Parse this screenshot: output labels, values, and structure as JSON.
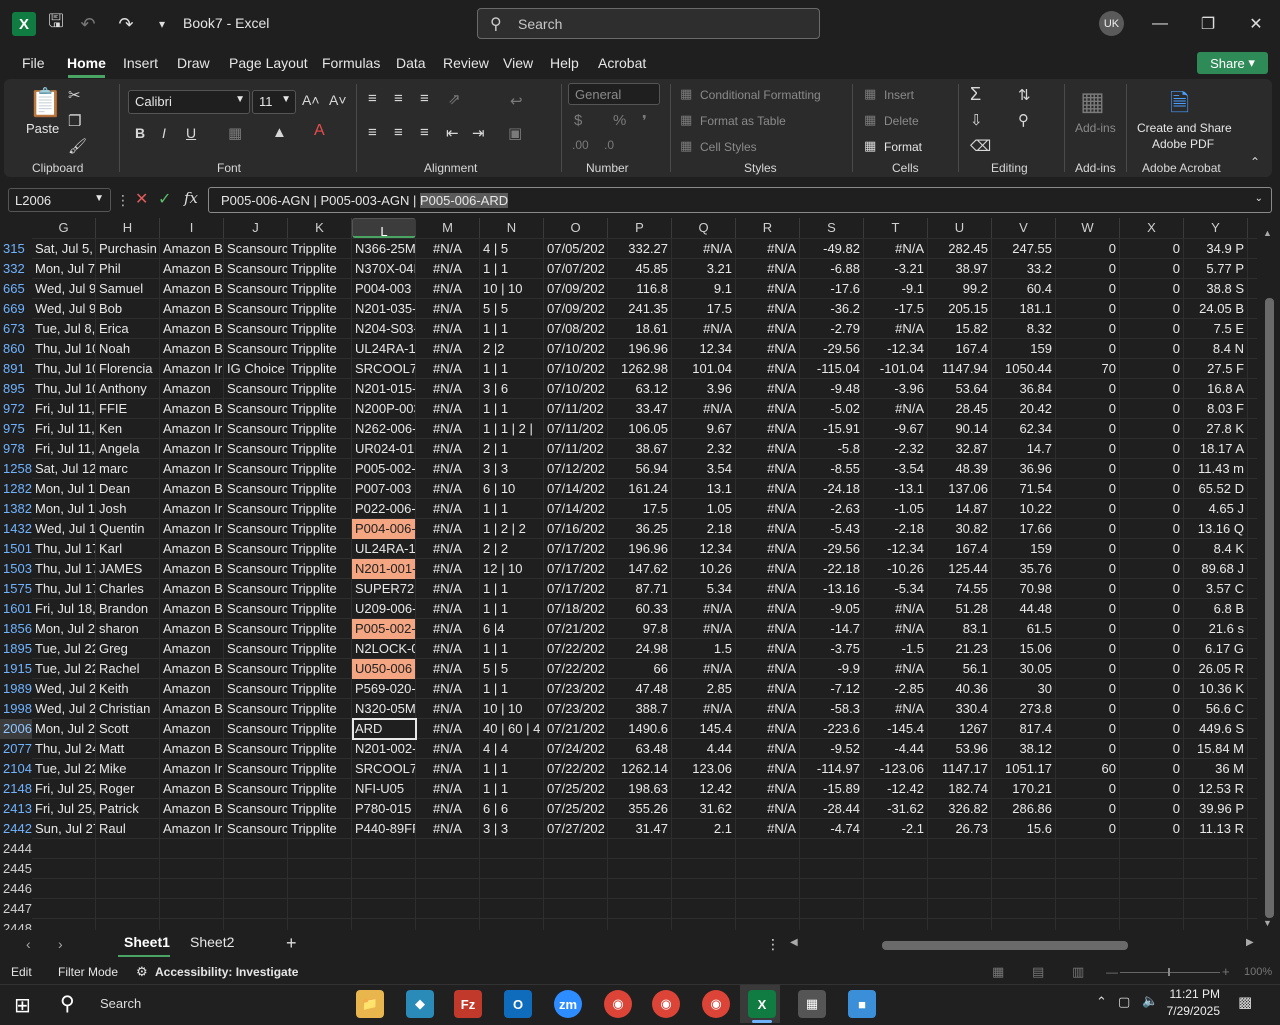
{
  "window": {
    "title": "Book7  -  Excel",
    "search_placeholder": "Search",
    "avatar": "UK"
  },
  "menu": [
    "File",
    "Home",
    "Insert",
    "Draw",
    "Page Layout",
    "Formulas",
    "Data",
    "Review",
    "View",
    "Help",
    "Acrobat"
  ],
  "share_label": "Share",
  "ribbon": {
    "clipboard": {
      "paste": "Paste",
      "label": "Clipboard"
    },
    "font": {
      "name": "Calibri",
      "size": "11",
      "label": "Font"
    },
    "alignment": {
      "label": "Alignment"
    },
    "number": {
      "format": "General",
      "label": "Number"
    },
    "styles": {
      "conditional": "Conditional Formatting",
      "table": "Format as Table",
      "cell": "Cell Styles",
      "label": "Styles"
    },
    "cells": {
      "insert": "Insert",
      "delete": "Delete",
      "format": "Format",
      "label": "Cells"
    },
    "editing": {
      "label": "Editing"
    },
    "addins": {
      "button": "Add-ins",
      "label": "Add-ins"
    },
    "acrobat": {
      "button_line1": "Create and Share",
      "button_line2": "Adobe PDF",
      "label": "Adobe Acrobat"
    }
  },
  "formula_bar": {
    "name_box": "L2006",
    "content_prefix": "P005-006-AGN | P005-003-AGN | ",
    "content_selected": "P005-006-ARD"
  },
  "columns": [
    "G",
    "H",
    "I",
    "J",
    "K",
    "L",
    "M",
    "N",
    "O",
    "P",
    "Q",
    "R",
    "S",
    "T",
    "U",
    "V",
    "W",
    "X",
    "Y"
  ],
  "rows": [
    {
      "n": "315",
      "c": [
        "Sat, Jul 5,",
        "Purchasin",
        "Amazon B",
        "Scansourc",
        "Tripplite",
        "N366-25M",
        "#N/A",
        "4 | 5",
        "07/05/202",
        "332.27",
        "#N/A",
        "#N/A",
        "-49.82",
        "#N/A",
        "282.45",
        "247.55",
        "0",
        "0",
        "34.9 P"
      ],
      "hl": false
    },
    {
      "n": "332",
      "c": [
        "Mon, Jul 7",
        "Phil",
        "Amazon B",
        "Scansourc",
        "Tripplite",
        "N370X-04I",
        "#N/A",
        "1 | 1",
        "07/07/202",
        "45.85",
        "3.21",
        "#N/A",
        "-6.88",
        "-3.21",
        "38.97",
        "33.2",
        "0",
        "0",
        "5.77 P"
      ],
      "hl": false
    },
    {
      "n": "665",
      "c": [
        "Wed, Jul 9",
        "Samuel",
        "Amazon B",
        "Scansourc",
        "Tripplite",
        "P004-003",
        "#N/A",
        "10 | 10",
        "07/09/202",
        "116.8",
        "9.1",
        "#N/A",
        "-17.6",
        "-9.1",
        "99.2",
        "60.4",
        "0",
        "0",
        "38.8 S"
      ],
      "hl": false
    },
    {
      "n": "669",
      "c": [
        "Wed, Jul 9",
        "Bob",
        "Amazon B",
        "Scansourc",
        "Tripplite",
        "N201-035-",
        "#N/A",
        "5 | 5",
        "07/09/202",
        "241.35",
        "17.5",
        "#N/A",
        "-36.2",
        "-17.5",
        "205.15",
        "181.1",
        "0",
        "0",
        "24.05 B"
      ],
      "hl": false
    },
    {
      "n": "673",
      "c": [
        "Tue, Jul 8,",
        "Erica",
        "Amazon B",
        "Scansourc",
        "Tripplite",
        "N204-S03-",
        "#N/A",
        "1 | 1",
        "07/08/202",
        "18.61",
        "#N/A",
        "#N/A",
        "-2.79",
        "#N/A",
        "15.82",
        "8.32",
        "0",
        "0",
        "7.5 E"
      ],
      "hl": false
    },
    {
      "n": "860",
      "c": [
        "Thu, Jul 10",
        "Noah",
        "Amazon B",
        "Scansourc",
        "Tripplite",
        "UL24RA-1!",
        "#N/A",
        "2 |2",
        "07/10/202",
        "196.96",
        "12.34",
        "#N/A",
        "-29.56",
        "-12.34",
        "167.4",
        "159",
        "0",
        "0",
        "8.4 N"
      ],
      "hl": false
    },
    {
      "n": "891",
      "c": [
        "Thu, Jul 10",
        "Florencia",
        "Amazon Ir",
        "IG Choice",
        "Tripplite",
        "SRCOOL7K",
        "#N/A",
        "1 | 1",
        "07/10/202",
        "1262.98",
        "101.04",
        "#N/A",
        "-115.04",
        "-101.04",
        "1147.94",
        "1050.44",
        "70",
        "0",
        "27.5 F"
      ],
      "hl": false
    },
    {
      "n": "895",
      "c": [
        "Thu, Jul 10",
        "Anthony",
        "Amazon",
        "Scansourc",
        "Tripplite",
        "N201-015-",
        "#N/A",
        "3 | 6",
        "07/10/202",
        "63.12",
        "3.96",
        "#N/A",
        "-9.48",
        "-3.96",
        "53.64",
        "36.84",
        "0",
        "0",
        "16.8 A"
      ],
      "hl": false
    },
    {
      "n": "972",
      "c": [
        "Fri, Jul 11,",
        "FFIE",
        "Amazon B",
        "Scansourc",
        "Tripplite",
        "N200P-003",
        "#N/A",
        "1 | 1",
        "07/11/202",
        "33.47",
        "#N/A",
        "#N/A",
        "-5.02",
        "#N/A",
        "28.45",
        "20.42",
        "0",
        "0",
        "8.03 F"
      ],
      "hl": false
    },
    {
      "n": "975",
      "c": [
        "Fri, Jul 11,",
        "Ken",
        "Amazon Ir",
        "Scansourc",
        "Tripplite",
        "N262-006-",
        "#N/A",
        "1 | 1 | 2 |",
        "07/11/202",
        "106.05",
        "9.67",
        "#N/A",
        "-15.91",
        "-9.67",
        "90.14",
        "62.34",
        "0",
        "0",
        "27.8 K"
      ],
      "hl": false
    },
    {
      "n": "978",
      "c": [
        "Fri, Jul 11,",
        "Angela",
        "Amazon Ir",
        "Scansourc",
        "Tripplite",
        "UR024-01C",
        "#N/A",
        "2 | 1",
        "07/11/202",
        "38.67",
        "2.32",
        "#N/A",
        "-5.8",
        "-2.32",
        "32.87",
        "14.7",
        "0",
        "0",
        "18.17 A"
      ],
      "hl": false
    },
    {
      "n": "1258",
      "c": [
        "Sat, Jul 12",
        "marc",
        "Amazon Ir",
        "Scansourc",
        "Tripplite",
        "P005-002-",
        "#N/A",
        "3 | 3",
        "07/12/202",
        "56.94",
        "3.54",
        "#N/A",
        "-8.55",
        "-3.54",
        "48.39",
        "36.96",
        "0",
        "0",
        "11.43 m"
      ],
      "hl": false
    },
    {
      "n": "1282",
      "c": [
        "Mon, Jul 1",
        "Dean",
        "Amazon B",
        "Scansourc",
        "Tripplite",
        "P007-003",
        "#N/A",
        "6 | 10",
        "07/14/202",
        "161.24",
        "13.1",
        "#N/A",
        "-24.18",
        "-13.1",
        "137.06",
        "71.54",
        "0",
        "0",
        "65.52 D"
      ],
      "hl": false
    },
    {
      "n": "1382",
      "c": [
        "Mon, Jul 1",
        "Josh",
        "Amazon Ir",
        "Scansourc",
        "Tripplite",
        "P022-006-",
        "#N/A",
        "1 | 1",
        "07/14/202",
        "17.5",
        "1.05",
        "#N/A",
        "-2.63",
        "-1.05",
        "14.87",
        "10.22",
        "0",
        "0",
        "4.65 J"
      ],
      "hl": false
    },
    {
      "n": "1432",
      "c": [
        "Wed, Jul 1",
        "Quentin",
        "Amazon Ir",
        "Scansourc",
        "Tripplite",
        "P004-006-",
        "#N/A",
        "1 | 2 | 2",
        "07/16/202",
        "36.25",
        "2.18",
        "#N/A",
        "-5.43",
        "-2.18",
        "30.82",
        "17.66",
        "0",
        "0",
        "13.16 Q"
      ],
      "hl": true
    },
    {
      "n": "1501",
      "c": [
        "Thu, Jul 17",
        "Karl",
        "Amazon B",
        "Scansourc",
        "Tripplite",
        "UL24RA-1!",
        "#N/A",
        "2 | 2",
        "07/17/202",
        "196.96",
        "12.34",
        "#N/A",
        "-29.56",
        "-12.34",
        "167.4",
        "159",
        "0",
        "0",
        "8.4 K"
      ],
      "hl": false
    },
    {
      "n": "1503",
      "c": [
        "Thu, Jul 17",
        "JAMES",
        "Amazon B",
        "Scansourc",
        "Tripplite",
        "N201-001-",
        "#N/A",
        "12 | 10",
        "07/17/202",
        "147.62",
        "10.26",
        "#N/A",
        "-22.18",
        "-10.26",
        "125.44",
        "35.76",
        "0",
        "0",
        "89.68 J"
      ],
      "hl": true
    },
    {
      "n": "1575",
      "c": [
        "Thu, Jul 17",
        "Charles",
        "Amazon B",
        "Scansourc",
        "Tripplite",
        "SUPER725",
        "#N/A",
        "1 | 1",
        "07/17/202",
        "87.71",
        "5.34",
        "#N/A",
        "-13.16",
        "-5.34",
        "74.55",
        "70.98",
        "0",
        "0",
        "3.57 C"
      ],
      "hl": false
    },
    {
      "n": "1601",
      "c": [
        "Fri, Jul 18,",
        "Brandon",
        "Amazon B",
        "Scansourc",
        "Tripplite",
        "U209-006-",
        "#N/A",
        "1 | 1",
        "07/18/202",
        "60.33",
        "#N/A",
        "#N/A",
        "-9.05",
        "#N/A",
        "51.28",
        "44.48",
        "0",
        "0",
        "6.8 B"
      ],
      "hl": false
    },
    {
      "n": "1856",
      "c": [
        "Mon, Jul 2",
        "sharon",
        "Amazon B",
        "Scansourc",
        "Tripplite",
        "P005-002-",
        "#N/A",
        "6 |4",
        "07/21/202",
        "97.8",
        "#N/A",
        "#N/A",
        "-14.7",
        "#N/A",
        "83.1",
        "61.5",
        "0",
        "0",
        "21.6 s"
      ],
      "hl": true
    },
    {
      "n": "1895",
      "c": [
        "Tue, Jul 22",
        "Greg",
        "Amazon",
        "Scansourc",
        "Tripplite",
        "N2LOCK-0",
        "#N/A",
        "1 | 1",
        "07/22/202",
        "24.98",
        "1.5",
        "#N/A",
        "-3.75",
        "-1.5",
        "21.23",
        "15.06",
        "0",
        "0",
        "6.17 G"
      ],
      "hl": false
    },
    {
      "n": "1915",
      "c": [
        "Tue, Jul 22",
        "Rachel",
        "Amazon B",
        "Scansourc",
        "Tripplite",
        "U050-006",
        "#N/A",
        "5 | 5",
        "07/22/202",
        "66",
        "#N/A",
        "#N/A",
        "-9.9",
        "#N/A",
        "56.1",
        "30.05",
        "0",
        "0",
        "26.05 R"
      ],
      "hl": true
    },
    {
      "n": "1989",
      "c": [
        "Wed, Jul 2",
        "Keith",
        "Amazon",
        "Scansourc",
        "Tripplite",
        "P569-020-",
        "#N/A",
        "1 | 1",
        "07/23/202",
        "47.48",
        "2.85",
        "#N/A",
        "-7.12",
        "-2.85",
        "40.36",
        "30",
        "0",
        "0",
        "10.36 K"
      ],
      "hl": false
    },
    {
      "n": "1998",
      "c": [
        "Wed, Jul 2",
        "Christian",
        "Amazon B",
        "Scansourc",
        "Tripplite",
        "N320-05M",
        "#N/A",
        "10 | 10",
        "07/23/202",
        "388.7",
        "#N/A",
        "#N/A",
        "-58.3",
        "#N/A",
        "330.4",
        "273.8",
        "0",
        "0",
        "56.6 C"
      ],
      "hl": false
    },
    {
      "n": "2006",
      "c": [
        "Mon, Jul 2",
        "Scott",
        "Amazon",
        "Scansourc",
        "Tripplite",
        "ARD",
        "#N/A",
        "40 | 60 | 4",
        "07/21/202",
        "1490.6",
        "145.4",
        "#N/A",
        "-223.6",
        "-145.4",
        "1267",
        "817.4",
        "0",
        "0",
        "449.6 S"
      ],
      "hl": false
    },
    {
      "n": "2077",
      "c": [
        "Thu, Jul 24",
        "Matt",
        "Amazon B",
        "Scansourc",
        "Tripplite",
        "N201-002-",
        "#N/A",
        "4 | 4",
        "07/24/202",
        "63.48",
        "4.44",
        "#N/A",
        "-9.52",
        "-4.44",
        "53.96",
        "38.12",
        "0",
        "0",
        "15.84 M"
      ],
      "hl": false
    },
    {
      "n": "2104",
      "c": [
        "Tue, Jul 22",
        "Mike",
        "Amazon Ir",
        "Scansourc",
        "Tripplite",
        "SRCOOL7K",
        "#N/A",
        "1 | 1",
        "07/22/202",
        "1262.14",
        "123.06",
        "#N/A",
        "-114.97",
        "-123.06",
        "1147.17",
        "1051.17",
        "60",
        "0",
        "36 M"
      ],
      "hl": false
    },
    {
      "n": "2148",
      "c": [
        "Fri, Jul 25,",
        "Roger",
        "Amazon B",
        "Scansourc",
        "Tripplite",
        "NFI-U05",
        "#N/A",
        "1 | 1",
        "07/25/202",
        "198.63",
        "12.42",
        "#N/A",
        "-15.89",
        "-12.42",
        "182.74",
        "170.21",
        "0",
        "0",
        "12.53 R"
      ],
      "hl": false
    },
    {
      "n": "2413",
      "c": [
        "Fri, Jul 25,",
        "Patrick",
        "Amazon B",
        "Scansourc",
        "Tripplite",
        "P780-015",
        "#N/A",
        "6 | 6",
        "07/25/202",
        "355.26",
        "31.62",
        "#N/A",
        "-28.44",
        "-31.62",
        "326.82",
        "286.86",
        "0",
        "0",
        "39.96 P"
      ],
      "hl": false
    },
    {
      "n": "2442",
      "c": [
        "Sun, Jul 27",
        "Raul",
        "Amazon Ir",
        "Scansourc",
        "Tripplite",
        "P440-89FF",
        "#N/A",
        "3 | 3",
        "07/27/202",
        "31.47",
        "2.1",
        "#N/A",
        "-4.74",
        "-2.1",
        "26.73",
        "15.6",
        "0",
        "0",
        "11.13 R"
      ],
      "hl": false
    }
  ],
  "empty_rows": [
    "2444",
    "2445",
    "2446",
    "2447",
    "2448"
  ],
  "sheets": [
    "Sheet1",
    "Sheet2"
  ],
  "status": {
    "mode": "Edit",
    "filter": "Filter Mode",
    "accessibility": "Accessibility: Investigate",
    "zoom": "100%"
  },
  "taskbar": {
    "search": "Search",
    "time": "11:21 PM",
    "date": "7/29/2025"
  },
  "colors": {
    "accent": "#107c41",
    "highlight": "#f4a582",
    "share": "#2e8b57"
  }
}
